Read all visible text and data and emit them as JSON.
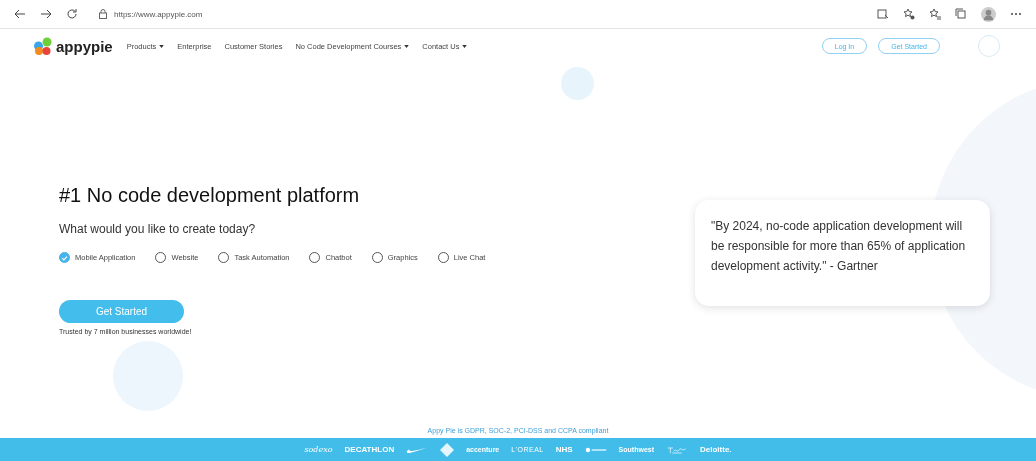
{
  "browser": {
    "url": "https://www.appypie.com"
  },
  "nav": {
    "logo": "appypie",
    "items": [
      {
        "label": "Products",
        "dropdown": true
      },
      {
        "label": "Enterprise",
        "dropdown": false
      },
      {
        "label": "Customer Stories",
        "dropdown": false
      },
      {
        "label": "No Code Development Courses",
        "dropdown": true
      },
      {
        "label": "Contact Us",
        "dropdown": true
      }
    ],
    "login": "Log In",
    "get_started": "Get Started"
  },
  "hero": {
    "title": "#1 No code development platform",
    "question": "What would you like to create today?",
    "options": [
      {
        "label": "Mobile Application",
        "selected": true
      },
      {
        "label": "Website",
        "selected": false
      },
      {
        "label": "Task Automation",
        "selected": false
      },
      {
        "label": "Chatbot",
        "selected": false
      },
      {
        "label": "Graphics",
        "selected": false
      },
      {
        "label": "Live Chat",
        "selected": false
      }
    ],
    "cta": "Get Started",
    "trust": "Trusted by 7 million businesses worldwide!"
  },
  "quote": "\"By 2024, no-code application development will be responsible for more than 65% of application development activity.\" - Gartner",
  "compliance": "Appy Pie is GDPR, SOC-2, PCI-DSS and CCPA compliant",
  "clients": [
    {
      "kind": "script",
      "text": "sodexo"
    },
    {
      "kind": "bold",
      "text": "DECATHLON"
    },
    {
      "kind": "swoosh"
    },
    {
      "kind": "badge"
    },
    {
      "kind": "small",
      "text": "accenture"
    },
    {
      "kind": "light",
      "text": "L'OREAL"
    },
    {
      "kind": "bold",
      "text": "NHS"
    },
    {
      "kind": "dotlogo"
    },
    {
      "kind": "small",
      "text": "Southwest"
    },
    {
      "kind": "scriptlogo"
    },
    {
      "kind": "bold",
      "text": "Deloitte."
    }
  ]
}
